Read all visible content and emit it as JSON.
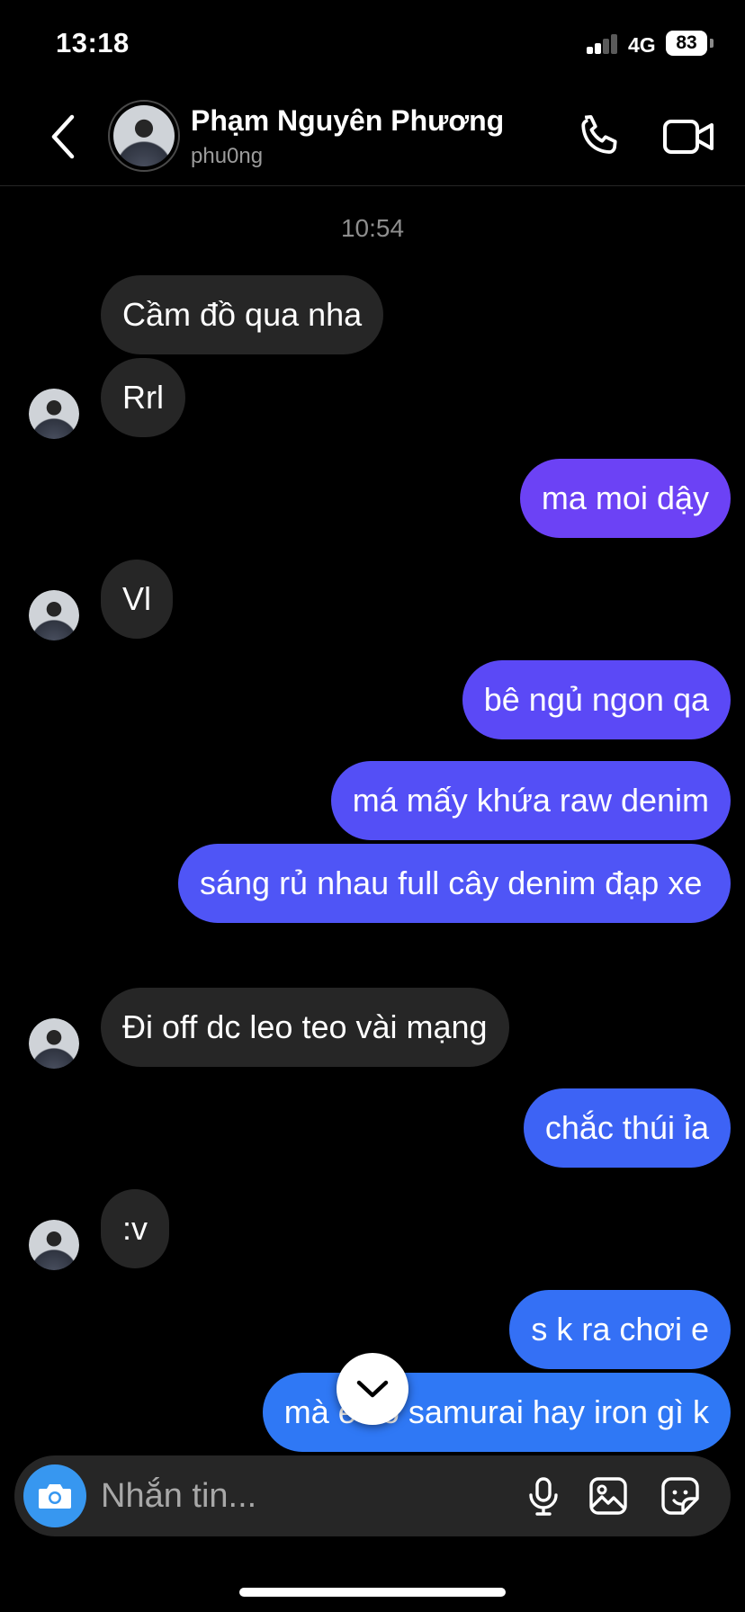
{
  "status_bar": {
    "time": "13:18",
    "network": "4G",
    "battery": "83"
  },
  "header": {
    "back_icon": "chevron-left-icon",
    "name": "Phạm Nguyên Phương",
    "username": "phu0ng",
    "call_icon": "phone-icon",
    "video_icon": "video-camera-icon"
  },
  "thread": {
    "timestamp": "10:54",
    "messages": [
      {
        "from": "them",
        "text": "Cầm đồ qua nha"
      },
      {
        "from": "them",
        "text": "Rrl"
      },
      {
        "from": "me",
        "text": "ma moi dậy"
      },
      {
        "from": "them",
        "text": "Vl"
      },
      {
        "from": "me",
        "text": "bê ngủ ngon qa"
      },
      {
        "from": "me",
        "text": "má mấy khứa raw denim"
      },
      {
        "from": "me",
        "text": "sáng rủ nhau full cây denim đạp xe"
      },
      {
        "from": "them",
        "text": "Đi off dc leo teo vài mạng"
      },
      {
        "from": "me",
        "text": "chắc thúi ỉa"
      },
      {
        "from": "them",
        "text": ":v"
      },
      {
        "from": "me",
        "text": "s k ra chơi e"
      },
      {
        "from": "me",
        "text": "mà e có samurai hay iron gì k"
      }
    ]
  },
  "composer": {
    "placeholder": "Nhắn tin...",
    "camera_icon": "camera-icon",
    "mic_icon": "microphone-icon",
    "gallery_icon": "image-icon",
    "sticker_icon": "sticker-icon"
  },
  "colors": {
    "background": "#000000",
    "incoming_bubble": "#262626",
    "outgoing_gradient_top": "#7b3ff2",
    "outgoing_gradient_bottom": "#2f7df5",
    "camera_button": "#3797f0",
    "muted_text": "#8e8e8e"
  }
}
